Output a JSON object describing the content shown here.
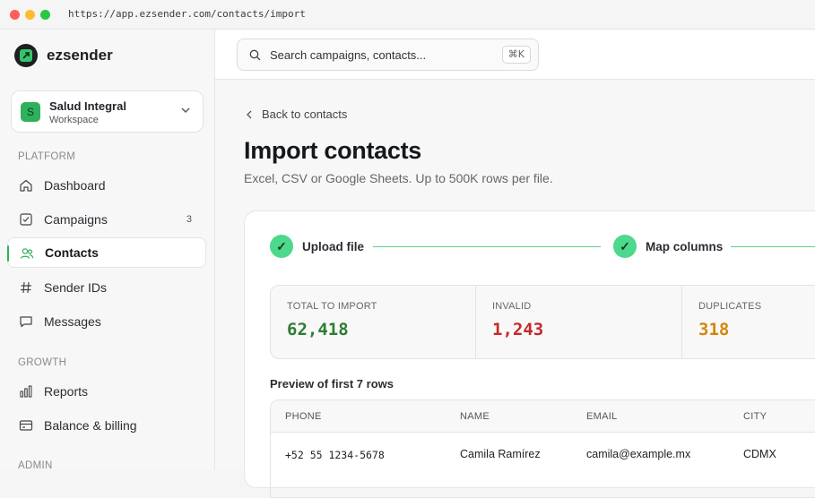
{
  "browser": {
    "url": "https://app.ezsender.com/contacts/import"
  },
  "brand": {
    "name": "ezsender"
  },
  "workspace": {
    "avatar_letter": "S",
    "name": "Salud Integral",
    "sub": "Workspace"
  },
  "sidebar": {
    "sections": [
      {
        "label": "PLATFORM"
      },
      {
        "label": "GROWTH"
      },
      {
        "label": "ADMIN"
      }
    ],
    "items": [
      {
        "label": "Dashboard",
        "icon": "home-icon"
      },
      {
        "label": "Campaigns",
        "icon": "checkbox-icon",
        "badge": "3"
      },
      {
        "label": "Contacts",
        "icon": "users-icon",
        "active": true
      },
      {
        "label": "Sender IDs",
        "icon": "hash-icon"
      },
      {
        "label": "Messages",
        "icon": "message-icon"
      },
      {
        "label": "Reports",
        "icon": "bar-chart-icon"
      },
      {
        "label": "Balance & billing",
        "icon": "credit-card-icon"
      }
    ]
  },
  "search": {
    "placeholder": "Search campaigns, contacts...",
    "shortcut": "⌘K"
  },
  "page": {
    "back_label": "Back to contacts",
    "title": "Import contacts",
    "subtitle": "Excel, CSV or Google Sheets. Up to 500K rows per file."
  },
  "steps": [
    {
      "label": "Upload file",
      "check": "✓"
    },
    {
      "label": "Map columns",
      "check": "✓"
    }
  ],
  "stats": [
    {
      "label": "TOTAL TO IMPORT",
      "value": "62,418",
      "color": "#2e7d32"
    },
    {
      "label": "INVALID",
      "value": "1,243",
      "color": "#c62828"
    },
    {
      "label": "DUPLICATES",
      "value": "318",
      "color": "#d4860b"
    }
  ],
  "preview": {
    "title": "Preview of first 7 rows",
    "columns": [
      "PHONE",
      "NAME",
      "EMAIL",
      "CITY"
    ],
    "rows": [
      [
        "+52 55 1234-5678",
        "Camila Ramírez",
        "camila@example.mx",
        "CDMX"
      ]
    ]
  }
}
